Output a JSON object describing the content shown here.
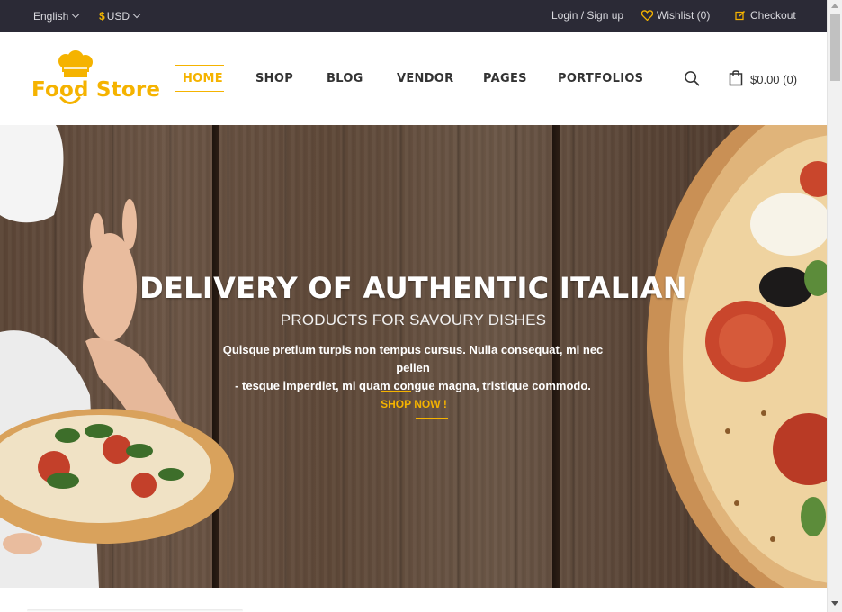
{
  "topbar": {
    "language": "English",
    "currency_symbol": "$",
    "currency": "USD",
    "login": "Login / Sign up",
    "wishlist": "Wishlist (0)",
    "checkout": "Checkout"
  },
  "header": {
    "logo_text": "Food Store",
    "nav": [
      "HOME",
      "SHOP",
      "BLOG",
      "VENDOR",
      "PAGES",
      "PORTFOLIOS"
    ],
    "active_nav": "HOME",
    "cart_total": "$0.00 (0)"
  },
  "hero": {
    "title": "DELIVERY OF AUTHENTIC ITALIAN",
    "subtitle": "PRODUCTS FOR SAVOURY DISHES",
    "text_line1": "Quisque pretium turpis non tempus cursus. Nulla consequat, mi nec pellen",
    "text_line2": "- tesque imperdiet, mi quam congue magna, tristique commodo.",
    "cta": "SHOP NOW !"
  },
  "colors": {
    "accent": "#f5b300",
    "topbar_bg": "#2b2a36",
    "wood": "#5e4838"
  },
  "icons": [
    "chevron-down-icon",
    "heart-icon",
    "edit-icon",
    "chef-hat-icon",
    "search-icon",
    "shopping-bag-icon"
  ]
}
